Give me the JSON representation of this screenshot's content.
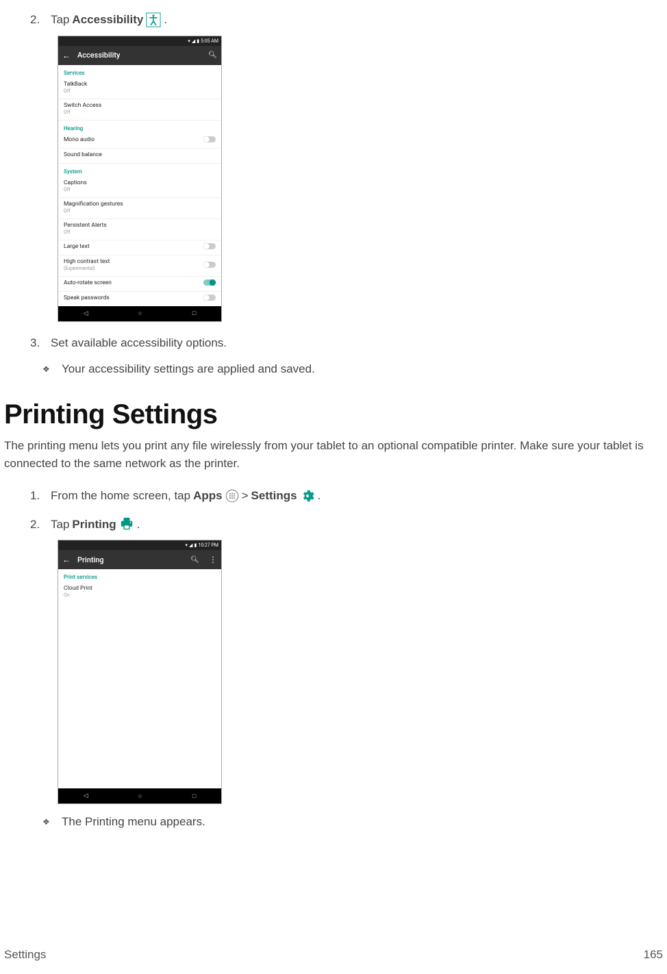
{
  "steps_top": {
    "s2": {
      "num": "2.",
      "pre": "Tap ",
      "bold": "Accessibility",
      "post": "."
    },
    "s3": {
      "num": "3.",
      "text": "Set available accessibility options."
    }
  },
  "note_top": "Your accessibility settings are applied and saved.",
  "heading": "Printing Settings",
  "lead": "The printing menu lets you print any file wirelessly from your tablet to an optional compatible printer. Make sure your tablet is connected to the same network as the printer.",
  "steps_print": {
    "s1": {
      "num": "1.",
      "pre": "From the home screen, tap ",
      "bold1": "Apps",
      "mid": " > ",
      "bold2": "Settings",
      "post": "."
    },
    "s2": {
      "num": "2.",
      "pre": "Tap ",
      "bold": "Printing",
      "post": "."
    }
  },
  "note_print": "The Printing menu appears.",
  "footer": {
    "left": "Settings",
    "right": "165"
  },
  "shot1": {
    "time": "5:05 AM",
    "title": "Accessibility",
    "cats": {
      "services": "Services",
      "hearing": "Hearing",
      "system": "System"
    },
    "rows": {
      "talkback": {
        "name": "TalkBack",
        "sub": "Off"
      },
      "switch": {
        "name": "Switch Access",
        "sub": "Off"
      },
      "mono": {
        "name": "Mono audio"
      },
      "balance": {
        "name": "Sound balance"
      },
      "captions": {
        "name": "Captions",
        "sub": "Off"
      },
      "mag": {
        "name": "Magnification gestures",
        "sub": "Off"
      },
      "persist": {
        "name": "Persistent Alerts",
        "sub": "Off"
      },
      "large": {
        "name": "Large text"
      },
      "contrast": {
        "name": "High contrast text",
        "sub": "(Experimental)"
      },
      "autorotate": {
        "name": "Auto-rotate screen"
      },
      "speakpw": {
        "name": "Speak passwords"
      }
    }
  },
  "shot2": {
    "time": "10:27 PM",
    "title": "Printing",
    "cat": "Print services",
    "row": {
      "name": "Cloud Print",
      "sub": "On"
    }
  }
}
